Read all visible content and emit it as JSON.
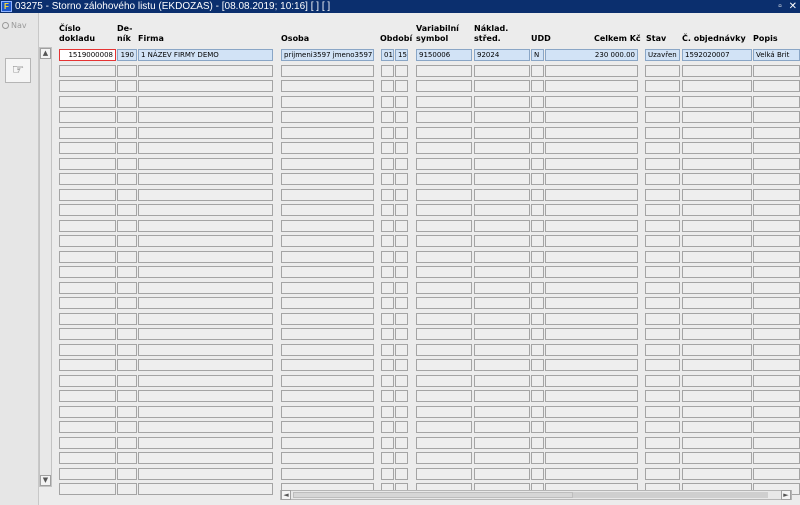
{
  "window": {
    "title": "03275 - Storno zálohového listu (EKDOZAS) - [08.08.2019; 10:16]  [ ]  [ ]",
    "restore_glyph": "▫",
    "close_glyph": "✕",
    "app_icon": "app-logo-icon"
  },
  "left_pane": {
    "nav_label": "Nav",
    "tool_icon": "hand-pointer-icon"
  },
  "columns": [
    {
      "line1": "Číslo",
      "line2": "dokladu"
    },
    {
      "line1": "De-",
      "line2": "ník"
    },
    {
      "line1": "",
      "line2": "Firma"
    },
    {
      "line1": "",
      "line2": "Osoba"
    },
    {
      "line1": "",
      "line2": "Období"
    },
    {
      "line1": "Variabilní",
      "line2": "symbol"
    },
    {
      "line1": "Náklad.",
      "line2": "střed."
    },
    {
      "line1": "",
      "line2": "UDD"
    },
    {
      "line1": "",
      "line2": "Celkem Kč"
    },
    {
      "line1": "",
      "line2": "Stav"
    },
    {
      "line1": "",
      "line2": "Č. objednávky"
    },
    {
      "line1": "",
      "line2": "Popis"
    }
  ],
  "rows": [
    {
      "cislo": "1519000008",
      "denik": "190",
      "firma": "1 NÁZEV FIRMY DEMO",
      "osoba": "prijmeni3597 jmeno3597",
      "obdobi_a": "01",
      "obdobi_b": "15",
      "var_symbol": "9150006",
      "nakl_stred": "92024",
      "udd": "N",
      "celkem": "230 000.00",
      "stav": "Uzavřen",
      "objednavka": "1592020007",
      "popis": "Velká Brit"
    }
  ],
  "empty_row_count": 28,
  "scroll": {
    "up": "▲",
    "down": "▼",
    "left": "◄",
    "right": "►"
  },
  "colors": {
    "title_bg": "#0b2f6e",
    "current_row": "#d2e3f6",
    "focus_border": "#e53434"
  }
}
